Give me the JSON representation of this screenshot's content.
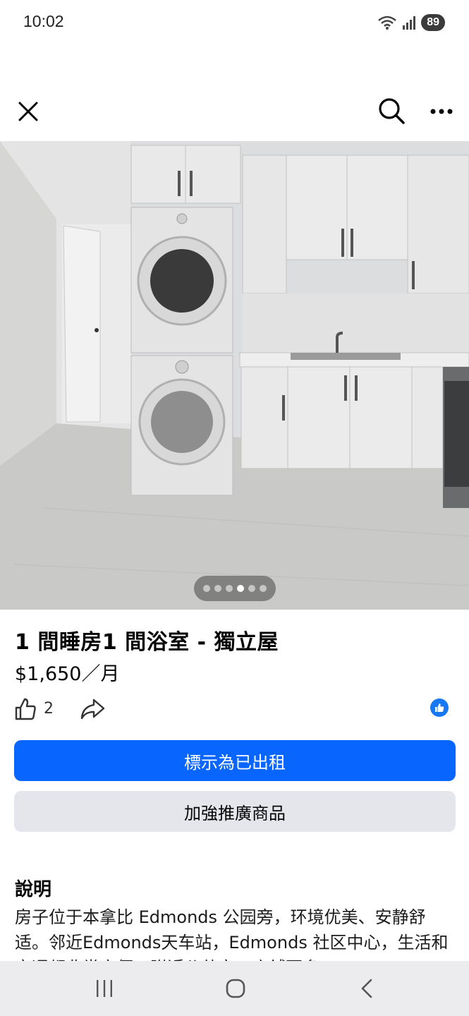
{
  "status": {
    "time": "10:02",
    "battery": "89"
  },
  "listing": {
    "title": "1 間睡房1 間浴室 - 獨立屋",
    "price": "$1,650／月",
    "like_count": "2",
    "photo_count": 6,
    "active_photo": 4
  },
  "buttons": {
    "mark_sold": "標示為已出租",
    "boost": "加強推廣商品"
  },
  "description": {
    "heading": "說明",
    "text": "房子位于本拿比 Edmonds 公园旁，环境优美、安静舒适。邻近Edmonds天车站，Edmonds 社区中心，生活和交通都非常方便。附近公共交、店舖更多。"
  },
  "colors": {
    "primary": "#0866ff",
    "secondary_bg": "#e4e6eb",
    "nav_bg": "#ececee"
  }
}
